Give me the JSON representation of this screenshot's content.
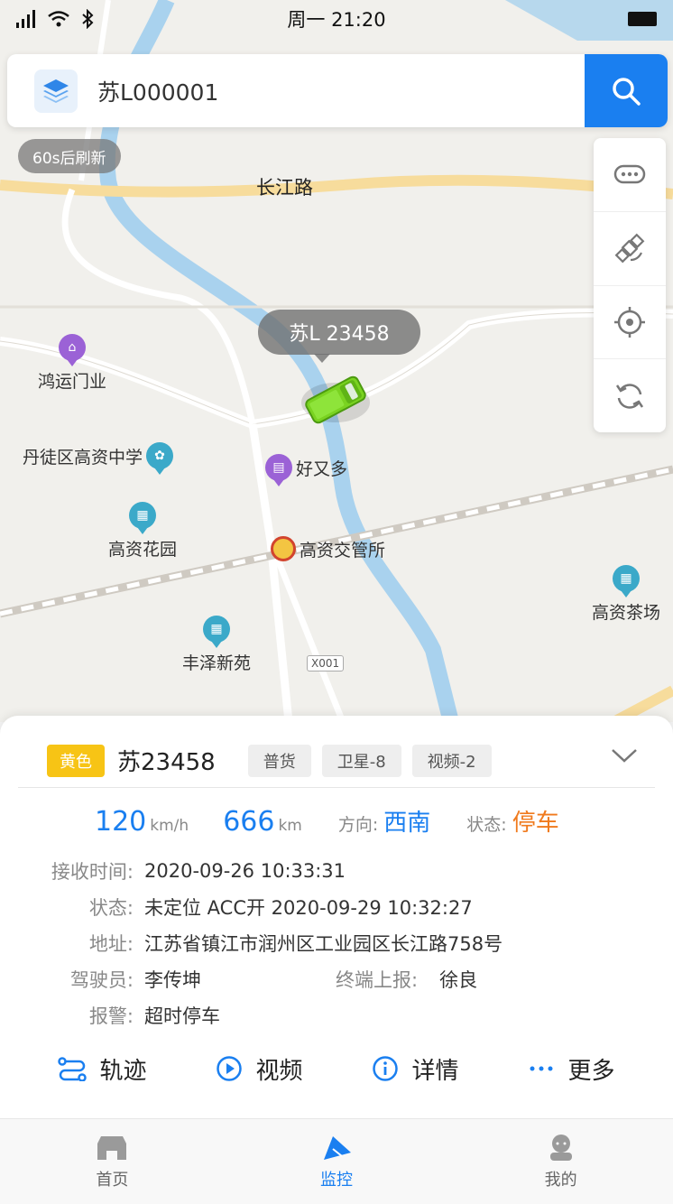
{
  "status_bar": {
    "time": "周一  21:20"
  },
  "search": {
    "value": "苏L000001"
  },
  "refresh_pill": "60s后刷新",
  "map": {
    "road_label": "长江路",
    "road_code": "X001",
    "vehicle_bubble": "苏L 23458",
    "pois": {
      "hongyun": "鸿运门业",
      "school": "丹徒区高资中学",
      "haoyouduo": "好又多",
      "garden": "高资花园",
      "police": "高资交管所",
      "tea": "高资茶场",
      "fengze": "丰泽新苑"
    }
  },
  "tools": [
    "message-icon",
    "satellite-icon",
    "locate-icon",
    "refresh-icon"
  ],
  "panel": {
    "color_badge": "黄色",
    "plate": "苏23458",
    "tags": [
      "普货",
      "卫星-8",
      "视频-2"
    ],
    "speed": "120",
    "speed_unit": "km/h",
    "mileage": "666",
    "mileage_unit": "km",
    "direction_label": "方向:",
    "direction": "西南",
    "state_label": "状态:",
    "state": "停车",
    "receive_label": "接收时间:",
    "receive_time": "2020-09-26 10:33:31",
    "status_label": "状态:",
    "status": "未定位 ACC开 2020-09-29 10:32:27",
    "address_label": "地址:",
    "address": "江苏省镇江市润州区工业园区长江路758号",
    "driver_label": "驾驶员:",
    "driver": "李传坤",
    "terminal_label": "终端上报:",
    "terminal": "徐良",
    "alarm_label": "报警:",
    "alarm": "超时停车",
    "actions": {
      "track": "轨迹",
      "video": "视频",
      "detail": "详情",
      "more": "更多"
    }
  },
  "tabbar": {
    "home": "首页",
    "monitor": "监控",
    "mine": "我的"
  },
  "colors": {
    "accent": "#1a7ff0",
    "warning": "#f07a1d",
    "badge": "#f7c415"
  }
}
